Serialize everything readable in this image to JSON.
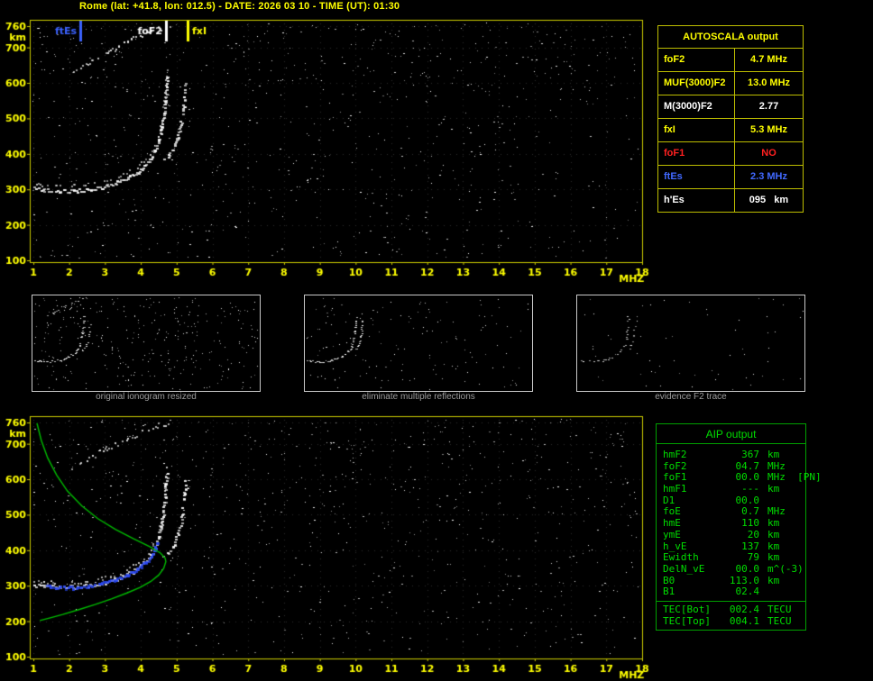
{
  "header": {
    "title": "Rome (lat: +41.8, lon: 012.5) - DATE: 2026 03 10 - TIME (UT): 01:30"
  },
  "autoscala": {
    "title": "AUTOSCALA output",
    "rows": [
      {
        "param": "foF2",
        "value": "4.7 MHz",
        "color": "#ffff00"
      },
      {
        "param": "MUF(3000)F2",
        "value": "13.0 MHz",
        "color": "#ffff00"
      },
      {
        "param": "M(3000)F2",
        "value": "2.77",
        "color": "#ffffff"
      },
      {
        "param": "fxI",
        "value": "5.3 MHz",
        "color": "#ffff00"
      },
      {
        "param": "foF1",
        "value": "NO",
        "color": "#ff2020"
      },
      {
        "param": "ftEs",
        "value": "2.3 MHz",
        "color": "#4169ff"
      },
      {
        "param": "h'Es",
        "value": "095   km",
        "color": "#ffffff"
      }
    ]
  },
  "panels": [
    {
      "caption": "original ionogram resized"
    },
    {
      "caption": "eliminate multiple reflections"
    },
    {
      "caption": "evidence F2 trace"
    }
  ],
  "aip": {
    "title": "AIP output",
    "rows": [
      {
        "param": "hmF2",
        "value": "367",
        "unit": "km"
      },
      {
        "param": "foF2",
        "value": "04.7",
        "unit": "MHz"
      },
      {
        "param": "foF1",
        "value": "00.0",
        "unit": "MHz  [PN]"
      },
      {
        "param": "hmF1",
        "value": "---",
        "unit": "km"
      },
      {
        "param": "D1",
        "value": "00.0",
        "unit": ""
      },
      {
        "param": "foE",
        "value": "0.7",
        "unit": "MHz"
      },
      {
        "param": "hmE",
        "value": "110",
        "unit": "km"
      },
      {
        "param": "ymE",
        "value": "20",
        "unit": "km"
      },
      {
        "param": "h_vE",
        "value": "137",
        "unit": "km"
      },
      {
        "param": "Ewidth",
        "value": "79",
        "unit": "km"
      },
      {
        "param": "DelN_vE",
        "value": "00.0",
        "unit": "m^(-3)"
      },
      {
        "param": "B0",
        "value": "113.0",
        "unit": "km"
      },
      {
        "param": "B1",
        "value": "02.4",
        "unit": ""
      }
    ],
    "tec_rows": [
      {
        "param": "TEC[Bot]",
        "value": "002.4",
        "unit": "TECU"
      },
      {
        "param": "TEC[Top]",
        "value": "004.1",
        "unit": "TECU"
      }
    ]
  },
  "chart_data": {
    "type": "scatter",
    "title": "ionogram (virtual height vs frequency)",
    "x_unit": "MHZ",
    "y_unit": "km",
    "x_range": [
      1,
      18
    ],
    "y_range": [
      100,
      760
    ],
    "x_ticks": [
      1,
      2,
      3,
      4,
      5,
      6,
      7,
      8,
      9,
      10,
      11,
      12,
      13,
      14,
      15,
      16,
      17,
      18
    ],
    "y_ticks": [
      760,
      700,
      600,
      500,
      400,
      300,
      200,
      100
    ],
    "markers": [
      {
        "label": "ftEs",
        "freq": 2.3,
        "color": "#3b62ff",
        "side": "left"
      },
      {
        "label": "foF2",
        "freq": 4.7,
        "color": "#ffffff",
        "side": "left"
      },
      {
        "label": "fxI",
        "freq": 5.3,
        "color": "#ffff00",
        "side": "right"
      }
    ],
    "traces": {
      "f2_ordinary": [
        [
          1.0,
          304
        ],
        [
          1.3,
          300
        ],
        [
          1.7,
          297
        ],
        [
          2.1,
          297
        ],
        [
          2.5,
          301
        ],
        [
          2.9,
          308
        ],
        [
          3.3,
          320
        ],
        [
          3.6,
          333
        ],
        [
          3.9,
          350
        ],
        [
          4.1,
          367
        ],
        [
          4.25,
          385
        ],
        [
          4.38,
          408
        ],
        [
          4.48,
          437
        ],
        [
          4.56,
          472
        ],
        [
          4.62,
          512
        ],
        [
          4.66,
          552
        ],
        [
          4.69,
          592
        ],
        [
          4.71,
          622
        ]
      ],
      "f2_extra": [
        [
          4.6,
          382
        ],
        [
          4.78,
          398
        ],
        [
          4.92,
          420
        ],
        [
          5.02,
          448
        ],
        [
          5.1,
          482
        ],
        [
          5.16,
          520
        ],
        [
          5.2,
          560
        ],
        [
          5.23,
          600
        ]
      ],
      "multiples": [
        [
          2.0,
          628
        ],
        [
          2.3,
          646
        ],
        [
          2.65,
          666
        ],
        [
          3.0,
          686
        ],
        [
          3.35,
          704
        ],
        [
          3.7,
          722
        ],
        [
          4.05,
          738
        ],
        [
          4.45,
          754
        ],
        [
          4.8,
          760
        ]
      ],
      "es_layer": [
        [
          1.0,
          112
        ],
        [
          2.3,
          110
        ]
      ],
      "profile": [
        [
          1.1,
          758
        ],
        [
          1.22,
          710
        ],
        [
          1.4,
          660
        ],
        [
          1.65,
          612
        ],
        [
          1.95,
          567
        ],
        [
          2.35,
          525
        ],
        [
          2.8,
          489
        ],
        [
          3.3,
          458
        ],
        [
          3.8,
          432
        ],
        [
          4.25,
          410
        ],
        [
          4.55,
          392
        ],
        [
          4.68,
          378
        ],
        [
          4.7,
          368
        ],
        [
          4.64,
          349
        ],
        [
          4.5,
          330
        ],
        [
          4.28,
          312
        ],
        [
          3.98,
          295
        ],
        [
          3.6,
          279
        ],
        [
          3.18,
          263
        ],
        [
          2.72,
          247
        ],
        [
          2.25,
          232
        ],
        [
          1.82,
          219
        ],
        [
          1.45,
          209
        ],
        [
          1.18,
          202
        ]
      ],
      "fitted": [
        [
          1.35,
          301
        ],
        [
          1.7,
          298
        ],
        [
          2.1,
          297
        ],
        [
          2.5,
          301
        ],
        [
          2.9,
          308
        ],
        [
          3.3,
          320
        ],
        [
          3.6,
          333
        ],
        [
          3.9,
          350
        ],
        [
          4.1,
          367
        ],
        [
          4.25,
          385
        ],
        [
          4.36,
          404
        ],
        [
          4.44,
          422
        ]
      ]
    },
    "colors": {
      "trace": "#ffffff",
      "profile": "#00bb00",
      "fitted": "#2846f0",
      "axis": "#ffff00",
      "frame": "#cccc00"
    }
  }
}
